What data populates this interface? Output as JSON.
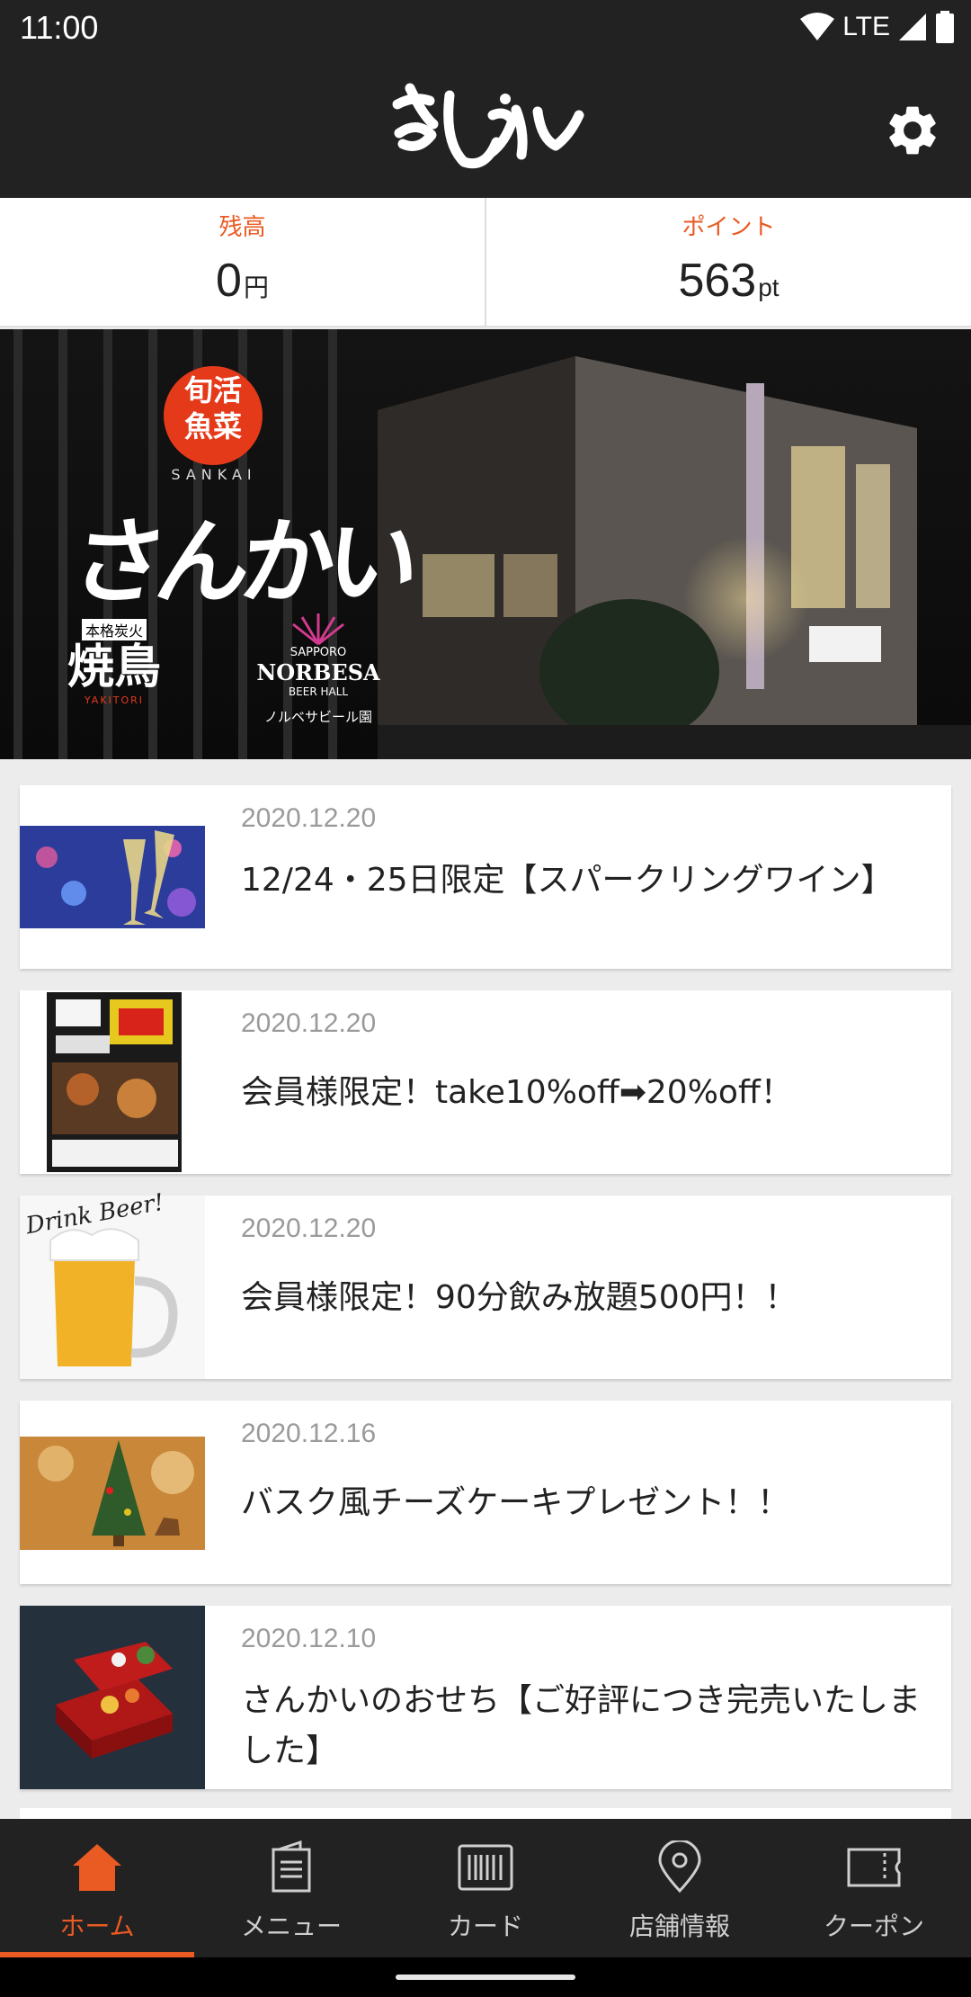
{
  "status_bar": {
    "time": "11:00",
    "network": "LTE"
  },
  "header": {
    "logo_text": "さんかい",
    "settings_icon": "gear-icon"
  },
  "balance": {
    "label": "残高",
    "value": "0",
    "unit": "円"
  },
  "points": {
    "label": "ポイント",
    "value": "563",
    "unit": "pt"
  },
  "hero": {
    "badge_line1": "旬活",
    "badge_line2": "魚菜",
    "brand_roman": "SANKAI",
    "brand_script": "さんかい",
    "sub_logo_top": "本格炭火",
    "sub_logo_main": "焼鳥",
    "sub_logo_roman": "YAKITORI",
    "beerhall_line1": "SAPPORO",
    "beerhall_line2": "NORBESA",
    "beerhall_line3": "BEER HALL",
    "beerhall_caption": "ノルベサビール園"
  },
  "news": [
    {
      "date": "2020.12.20",
      "title": "12/24・25日限定【スパークリングワイン】",
      "thumb": "champagne"
    },
    {
      "date": "2020.12.20",
      "title": "会員様限定！take10%off➡20%off！",
      "thumb": "flyer"
    },
    {
      "date": "2020.12.20",
      "title": "会員様限定！90分飲み放題500円！！",
      "thumb": "beer",
      "thumb_text": "Drink Beer!"
    },
    {
      "date": "2020.12.16",
      "title": "バスク風チーズケーキプレゼント！！",
      "thumb": "christmas-tree"
    },
    {
      "date": "2020.12.10",
      "title": "さんかいのおせち【ご好評につき完売いたしました】",
      "thumb": "osechi"
    }
  ],
  "bottom_nav": [
    {
      "label": "ホーム",
      "icon": "home-icon",
      "active": true
    },
    {
      "label": "メニュー",
      "icon": "menu-book-icon",
      "active": false
    },
    {
      "label": "カード",
      "icon": "barcode-card-icon",
      "active": false
    },
    {
      "label": "店舗情報",
      "icon": "location-pin-icon",
      "active": false
    },
    {
      "label": "クーポン",
      "icon": "coupon-ticket-icon",
      "active": false
    }
  ],
  "colors": {
    "accent": "#ea5a23",
    "bar": "#222222",
    "background": "#ececec"
  }
}
